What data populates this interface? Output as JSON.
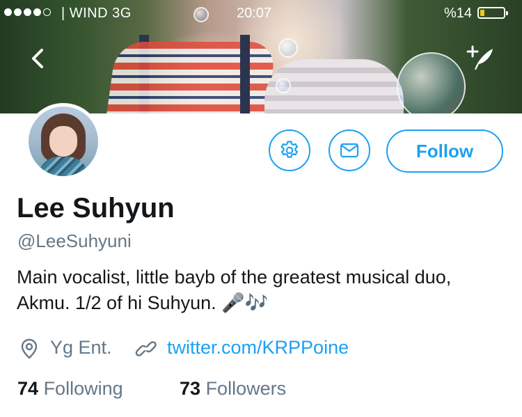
{
  "status_bar": {
    "carrier": "| WIND   3G",
    "time": "20:07",
    "battery": "%14"
  },
  "header": {
    "back_icon": "chevron-left-icon",
    "compose_icon": "compose-tweet-icon"
  },
  "actions": {
    "settings_icon": "gear-icon",
    "message_icon": "envelope-icon",
    "follow_label": "Follow"
  },
  "profile": {
    "name": "Lee Suhyun",
    "handle": "@LeeSuhyuni",
    "bio": "Main vocalist, little bayb of the greatest musical duo, Akmu. 1/2 of hi Suhyun. 🎤🎶",
    "location": "Yg Ent.",
    "link": "twitter.com/KRPPoine"
  },
  "stats": {
    "following_count": "74",
    "following_label": "Following",
    "followers_count": "73",
    "followers_label": "Followers"
  },
  "colors": {
    "accent": "#1da1f2",
    "secondary_text": "#657786",
    "primary_text": "#14171a"
  }
}
